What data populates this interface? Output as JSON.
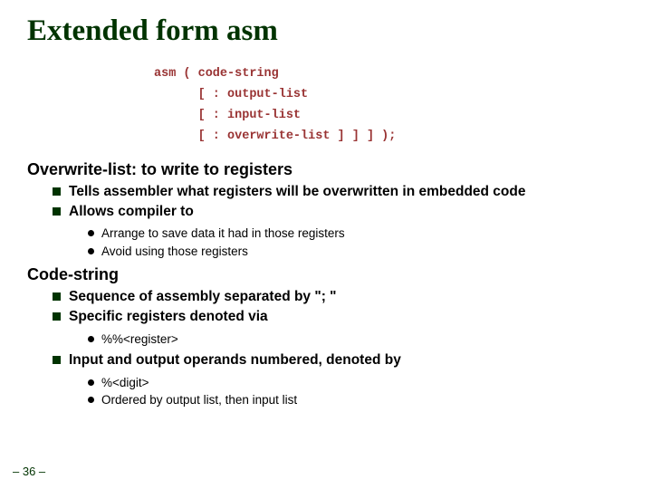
{
  "title": "Extended form asm",
  "code": {
    "l1": "asm ( code-string",
    "l2": "      [ : output-list",
    "l3": "      [ : input-list",
    "l4": "      [ : overwrite-list ] ] ] );"
  },
  "sec1": {
    "heading": "Overwrite-list: to write to registers",
    "b1": "Tells assembler what registers will be overwritten in embedded code",
    "b2": "Allows compiler to",
    "sub1": "Arrange to save data it had in those registers",
    "sub2": "Avoid using those registers"
  },
  "sec2": {
    "heading": "Code-string",
    "b1": "Sequence of assembly separated by \"; \"",
    "b2": "Specific registers denoted via",
    "sub1": "%%<register>",
    "b3": "Input and output operands  numbered, denoted by",
    "sub2": "%<digit>",
    "sub3": "Ordered by output list, then input list"
  },
  "pagenum": "– 36 –"
}
